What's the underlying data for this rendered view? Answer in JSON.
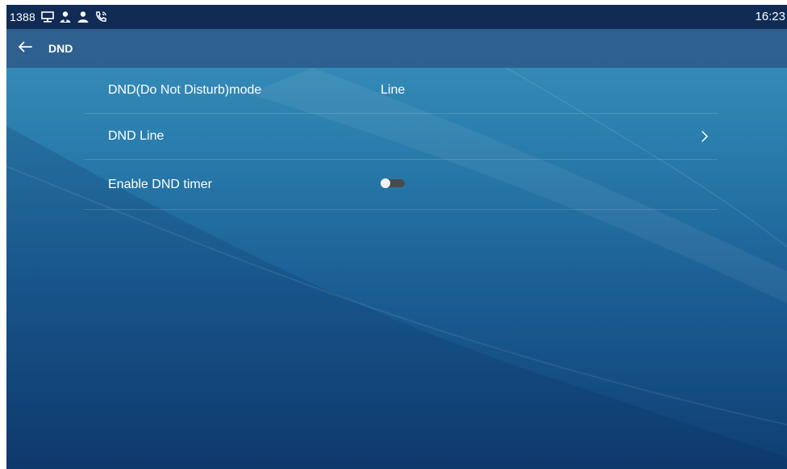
{
  "status_bar": {
    "extension": "1388",
    "icons": [
      "computer-icon",
      "contacts-icon",
      "person-icon",
      "phone-call-icon"
    ],
    "time": "16:23"
  },
  "header": {
    "title": "DND",
    "back_icon": "arrow-left-icon"
  },
  "settings": [
    {
      "label": "DND(Do Not Disturb)mode",
      "value": "Line"
    },
    {
      "label": "DND Line",
      "value": "",
      "chevron_icon": "chevron-right-icon"
    },
    {
      "label": "Enable DND timer",
      "toggle_on": false
    }
  ],
  "colors": {
    "status_bar_bg": "#102c55",
    "title_bar_bg": "#2e5c8c",
    "background_top": "#3c93bd",
    "background_bottom": "#0f3e72",
    "toggle_off_track": "#4a4a4a"
  }
}
